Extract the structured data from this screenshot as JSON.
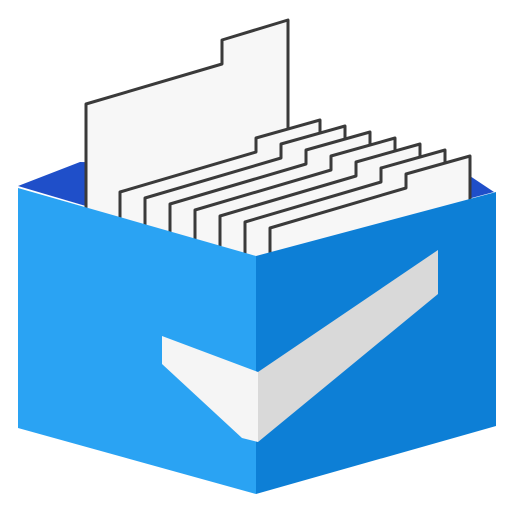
{
  "icon": {
    "name": "file-box-checkmark-icon",
    "colors": {
      "background": "#ffffff",
      "box_left_face": "#2aa3f3",
      "box_right_face": "#0d7fd6",
      "box_interior": "#1f4fc9",
      "paper_fill": "#f7f7f7",
      "paper_outline": "#3a3a3a",
      "check_light": "#f5f5f5",
      "check_shadow": "#d9d9d9"
    },
    "file_sheet_count": 7
  }
}
